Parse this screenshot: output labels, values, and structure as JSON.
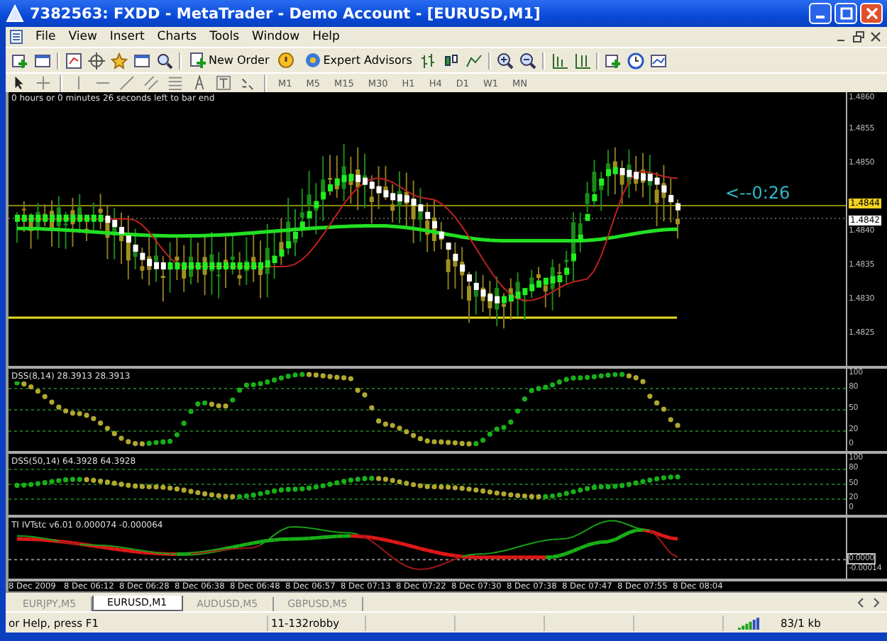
{
  "window": {
    "title": "7382563: FXDD - MetaTrader - Demo Account - [EURUSD,M1]"
  },
  "menu": [
    "File",
    "View",
    "Insert",
    "Charts",
    "Tools",
    "Window",
    "Help"
  ],
  "toolbar": {
    "buttons": [
      {
        "label": "New Order",
        "kind": "order"
      },
      {
        "label": "Expert Advisors",
        "kind": "experts"
      }
    ]
  },
  "timeframes": [
    "M1",
    "M5",
    "M15",
    "M30",
    "H1",
    "H4",
    "D1",
    "W1",
    "MN"
  ],
  "chart": {
    "countdown_text": "0 hours or 0 minutes 26 seconds left to bar end",
    "timer": "<--0:26",
    "price_axis": [
      "1.4860",
      "1.4855",
      "1.4850",
      "1.4840",
      "1.4835",
      "1.4830",
      "1.4825"
    ],
    "bid_price": "1.4844",
    "ask_price": "1.4842"
  },
  "indicators": [
    {
      "kind": "dots",
      "label": "DSS(8,14) 28.3913 28.3913",
      "axis": [
        "100",
        "80",
        "50",
        "20",
        "0"
      ]
    },
    {
      "kind": "dots",
      "label": "DSS(50,14) 64.3928 64.3928",
      "axis": [
        "100",
        "80",
        "50",
        "20",
        "0"
      ]
    },
    {
      "kind": "lines",
      "label": "TI IVTstc v6.01 0.000074 -0.000064",
      "axis": [
        "0.0000",
        "-0.00014"
      ]
    }
  ],
  "time_axis": [
    "8 Dec 2009",
    "8 Dec 06:12",
    "8 Dec 06:28",
    "8 Dec 06:38",
    "8 Dec 06:48",
    "8 Dec 06:57",
    "8 Dec 07:13",
    "8 Dec 07:22",
    "8 Dec 07:30",
    "8 Dec 07:38",
    "8 Dec 07:47",
    "8 Dec 07:55",
    "8 Dec 08:04"
  ],
  "tabs": [
    {
      "label": "EURJPY,M5",
      "selected": false
    },
    {
      "label": "EURUSD,M1",
      "selected": true
    },
    {
      "label": "AUDUSD,M5",
      "selected": false
    },
    {
      "label": "GBPUSD,M5",
      "selected": false
    }
  ],
  "status_bar": {
    "help": "or Help, press F1",
    "profile": "11-132robby",
    "traffic": "83/1 kb"
  }
}
